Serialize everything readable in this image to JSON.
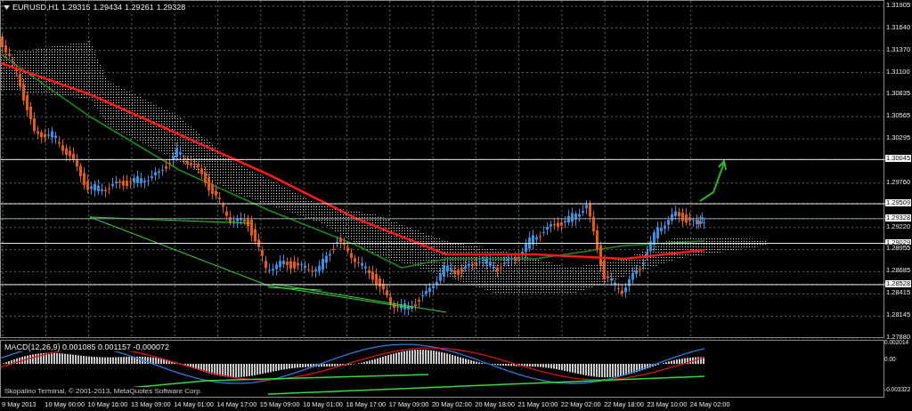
{
  "chart": {
    "symbol": "EURUSD,H1",
    "ohlc": [
      "1.29315",
      "1.29434",
      "1.29261",
      "1.29328"
    ],
    "price_axis": [
      {
        "label": "1.31905",
        "kind": "tick"
      },
      {
        "label": "1.31640",
        "kind": "tick"
      },
      {
        "label": "1.31370",
        "kind": "tick"
      },
      {
        "label": "1.31100",
        "kind": "tick"
      },
      {
        "label": "1.30835",
        "kind": "tick"
      },
      {
        "label": "1.30565",
        "kind": "tick"
      },
      {
        "label": "1.30295",
        "kind": "tick"
      },
      {
        "label": "1.30045",
        "kind": "level"
      },
      {
        "label": "1.29760",
        "kind": "tick"
      },
      {
        "label": "1.29509",
        "kind": "level"
      },
      {
        "label": "1.29328",
        "kind": "price"
      },
      {
        "label": "1.29220",
        "kind": "tick"
      },
      {
        "label": "1.29029",
        "kind": "level"
      },
      {
        "label": "1.28955",
        "kind": "tick"
      },
      {
        "label": "1.28685",
        "kind": "tick"
      },
      {
        "label": "1.28528",
        "kind": "level"
      },
      {
        "label": "1.28415",
        "kind": "tick"
      },
      {
        "label": "1.28145",
        "kind": "tick"
      },
      {
        "label": "1.27880",
        "kind": "tick"
      }
    ]
  },
  "macd": {
    "label": "MACD(12,26,9) 0.001085 0.001157 -0.000072",
    "axis": [
      "0.002014",
      "0.00",
      "-0.003322"
    ]
  },
  "copyright": "Skopalino Terminal, © 2001-2013, MetaQuotes Software Corp.",
  "time_axis": [
    "9 May 2013",
    "10 May 00:00",
    "10 May 16:00",
    "13 May 09:00",
    "14 May 01:00",
    "14 May 17:00",
    "15 May 09:00",
    "16 May 01:00",
    "16 May 17:00",
    "17 May 09:00",
    "20 May 02:00",
    "20 May 18:00",
    "21 May 10:00",
    "22 May 02:00",
    "22 May 18:00",
    "23 May 10:00",
    "24 May 02:00"
  ]
}
